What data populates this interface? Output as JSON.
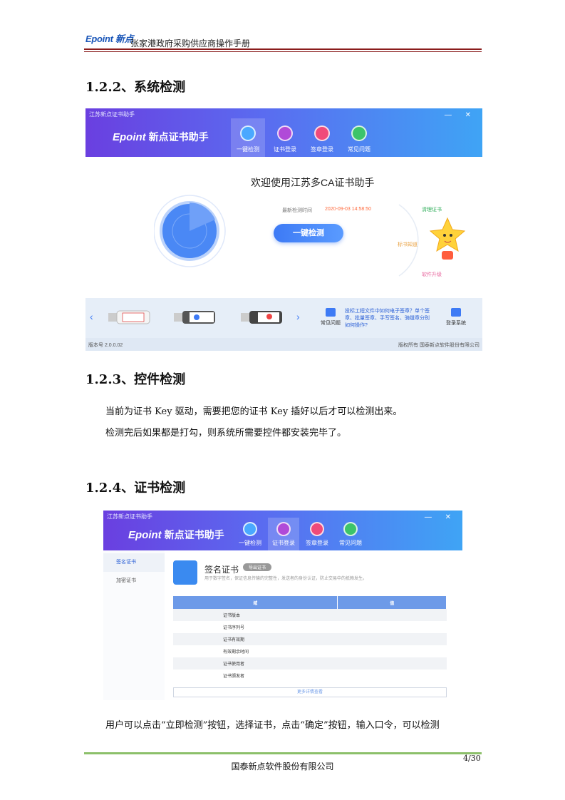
{
  "header": {
    "logo": "Epoint 新点",
    "title": "张家港政府采购供应商操作手册"
  },
  "sections": {
    "s1": "1.2.2、系统检测",
    "s2": "1.2.3、控件检测",
    "s3": "1.2.4、证书检测"
  },
  "paragraphs": {
    "p1": "当前为证书 Key 驱动，需要把您的证书 Key 插好以后才可以检测出来。",
    "p2": "检测完后如果都是打勾，则系统所需要控件都安装完毕了。",
    "p3": "用户可以点击“立即检测”按钮，选择证书，点击“确定”按钮，输入口令，可以检测"
  },
  "app1": {
    "window_title": "江苏新点证书助手",
    "window_controls": "— ✕",
    "brand_logo": "Epoint",
    "brand_name": "新点证书助手",
    "nav": [
      "一键检测",
      "证书登录",
      "签章登录",
      "常见问题"
    ],
    "welcome": "欢迎使用江苏多CA证书助手",
    "last_check_label": "最新检测时间",
    "last_check_value": "2020-09-03 14:58:50",
    "check_button": "一键检测",
    "options": [
      "清理证书",
      "标书知道",
      "软件升级"
    ],
    "toolbar_faq": "常见问题",
    "toolbar_link": "投标工程文件中如何电子签章？单个签章、批量签章、手写签名、骑缝章分别如何操作?",
    "toolbar_login": "登录系统",
    "version": "版本号  2.0.0.02",
    "copyright": "版权所有 国泰新点软件股份有限公司",
    "colors": {
      "gradient_start": "#6a3fe0",
      "gradient_end": "#3fa4f5",
      "accent": "#3d7af5"
    }
  },
  "app2": {
    "window_title": "江苏新点证书助手",
    "window_controls": "— ✕",
    "brand_logo": "Epoint",
    "brand_name": "新点证书助手",
    "nav": [
      "一键检测",
      "证书登录",
      "签章登录",
      "常见问题"
    ],
    "sidebar": [
      "签名证书",
      "加密证书"
    ],
    "cert_title": "签名证书",
    "cert_button": "导出证书",
    "cert_desc": "用于数字签名，保证信息传输的完整性，发送者的身份认证，防止交易中的抵赖发生。",
    "table_headers": [
      "域",
      "值"
    ],
    "table_rows": [
      "证书版本",
      "证书序列号",
      "证书有效期",
      "有效剩余时间",
      "证书使用者",
      "证书颁发者"
    ],
    "more_button": "更多详情查看"
  },
  "footer": {
    "page": "4/30",
    "company": "国泰新点软件股份有限公司"
  }
}
